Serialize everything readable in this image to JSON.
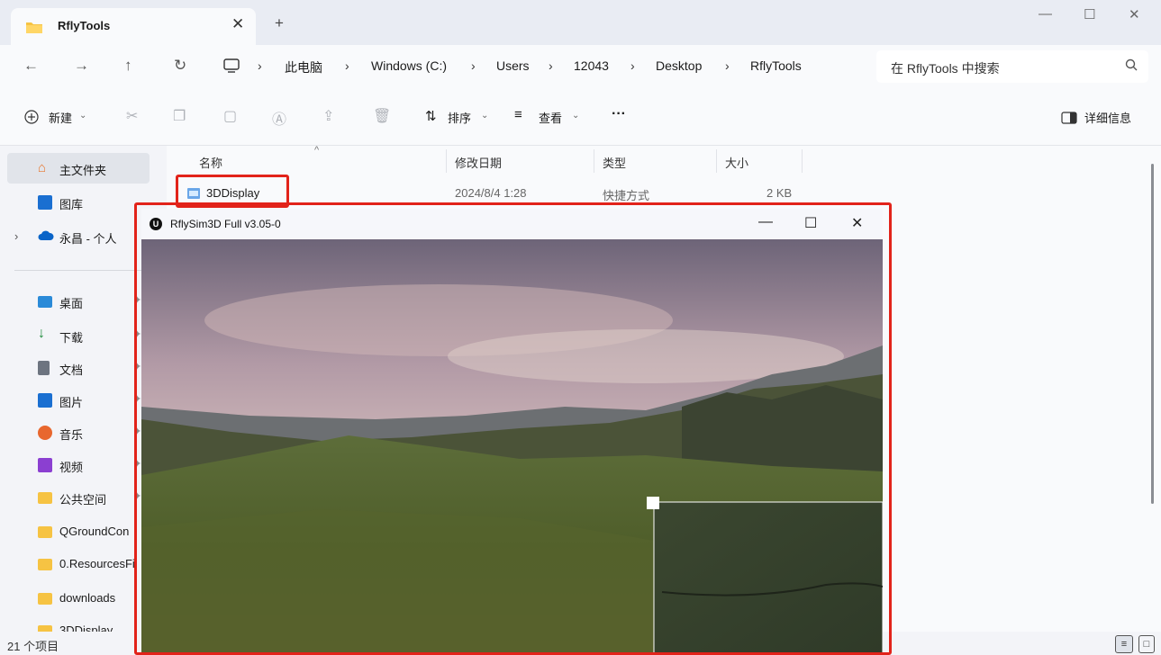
{
  "explorer": {
    "tab_title": "RflyTools",
    "tab_close": "✕",
    "new_tab": "+",
    "window_controls": {
      "minimize": "—",
      "maximize": "☐",
      "close": "✕"
    },
    "nav": {
      "back": "←",
      "forward": "→",
      "up": "↑",
      "refresh": "↻"
    },
    "breadcrumb": [
      "此电脑",
      "Windows (C:)",
      "Users",
      "12043",
      "Desktop",
      "RflyTools"
    ],
    "breadcrumb_sep": "›",
    "search_placeholder": "在 RflyTools 中搜索",
    "commands": {
      "new": "新建",
      "sort": "排序",
      "view": "查看",
      "more": "···",
      "details": "详细信息"
    },
    "sidebar": {
      "home": "主文件夹",
      "gallery": "图库",
      "onedrive": "永昌 - 个人",
      "desktop": "桌面",
      "downloads": "下载",
      "documents": "文档",
      "pictures": "图片",
      "music": "音乐",
      "videos": "视频",
      "public": "公共空间",
      "qgc": "QGroundCon",
      "resources": "0.ResourcesFi",
      "dl_folder": "downloads",
      "display3d": "3DDisplay"
    },
    "columns": {
      "name": "名称",
      "modified": "修改日期",
      "type": "类型",
      "size": "大小"
    },
    "rows": [
      {
        "name": "3DDisplay",
        "modified": "2024/8/4 1:28",
        "type": "快捷方式",
        "size": "2 KB"
      }
    ],
    "status_count": "21 个项目",
    "colors": {
      "highlight": "#e2231a",
      "accent": "#0067c0"
    }
  },
  "sim_window": {
    "title": "RflySim3D Full v3.05-0",
    "logo": "U",
    "controls": {
      "minimize": "—",
      "maximize": "☐",
      "close": "✕"
    }
  }
}
